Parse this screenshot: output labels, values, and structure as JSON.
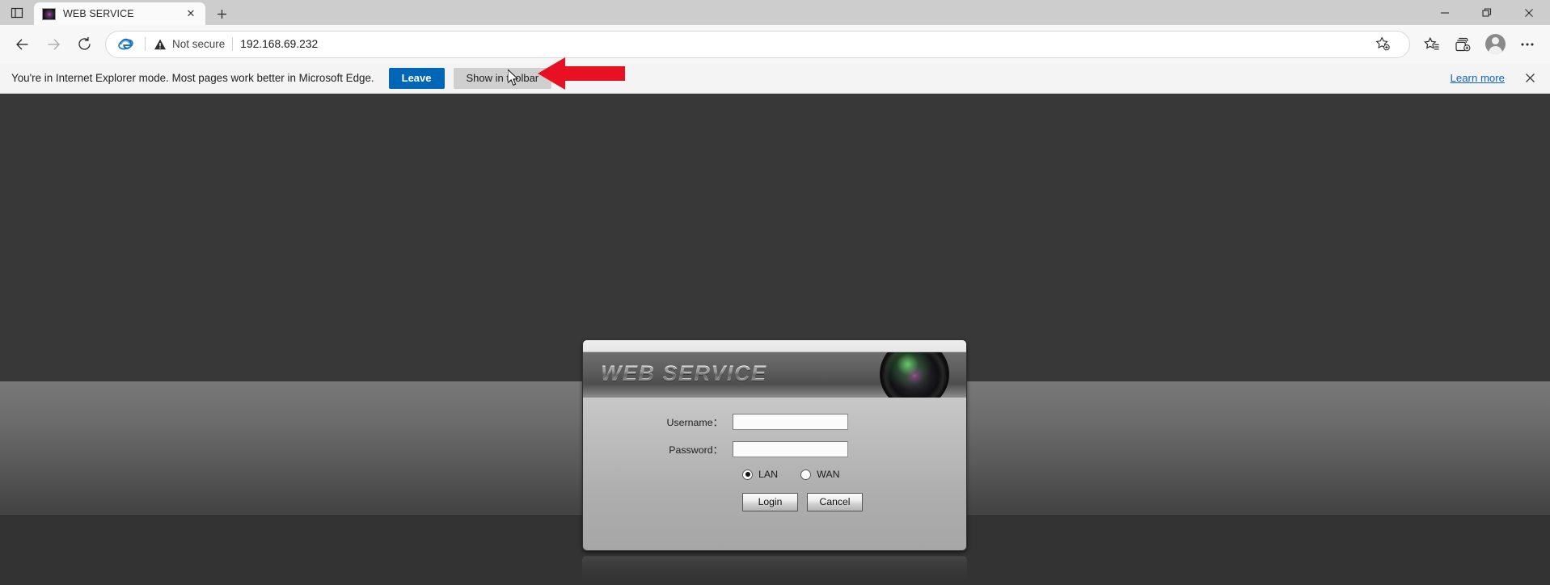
{
  "browser": {
    "tab": {
      "title": "WEB SERVICE",
      "favicon_name": "camera-lens-favicon",
      "close_label": "✕"
    },
    "new_tab_label": "+",
    "tab_actions_label": "tab-actions",
    "window_controls": {
      "minimize": "—",
      "restore": "restore",
      "close": "✕"
    },
    "nav": {
      "back": "back",
      "forward": "forward",
      "refresh": "refresh"
    },
    "omnibox": {
      "ie_badge_label": "Internet Explorer mode",
      "security_label": "Not secure",
      "url": "192.168.69.232"
    },
    "toolbar": {
      "add_favorite": "add-this-page-to-favorites",
      "favorites": "favorites",
      "collections": "collections",
      "profile": "profile",
      "settings": "settings-and-more"
    }
  },
  "ie_bar": {
    "message": "You're in Internet Explorer mode. Most pages work better in Microsoft Edge.",
    "leave_label": "Leave",
    "show_in_toolbar_label": "Show in toolbar",
    "learn_more_label": "Learn more",
    "close_label": "✕",
    "annotation": {
      "type": "red-arrow",
      "points_to": "show-in-toolbar-button",
      "color": "#e81123",
      "direction": "left"
    }
  },
  "page": {
    "login_dialog": {
      "title": "WEB  SERVICE",
      "lens_icon": "camera-lens",
      "fields": [
        {
          "label": "Username：",
          "value": "",
          "type": "text",
          "name": "username"
        },
        {
          "label": "Password：",
          "value": "",
          "type": "password",
          "name": "password"
        }
      ],
      "network_options": [
        {
          "label": "LAN",
          "selected": true
        },
        {
          "label": "WAN",
          "selected": false
        }
      ],
      "buttons": [
        {
          "label": "Login",
          "name": "login"
        },
        {
          "label": "Cancel",
          "name": "cancel"
        }
      ]
    },
    "background": {
      "top_color": "#383838",
      "mid_gradient_from": "#787878",
      "mid_gradient_to": "#434343",
      "bottom_color": "#333333"
    }
  }
}
